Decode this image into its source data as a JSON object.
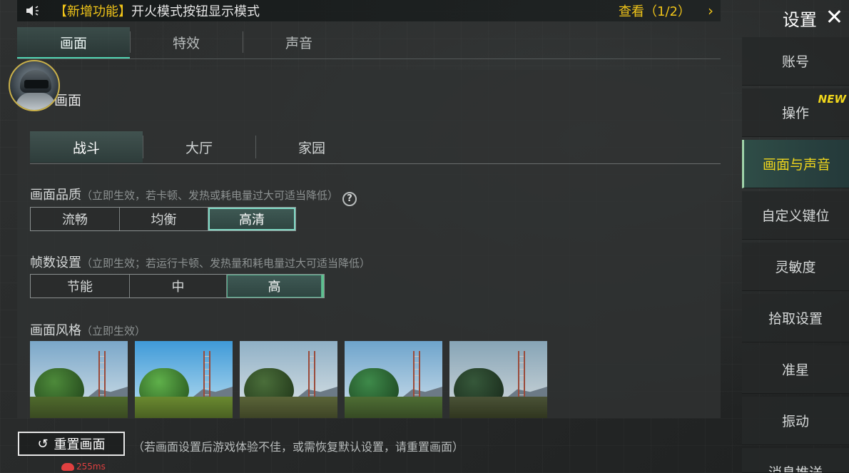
{
  "notice": {
    "speaker_icon": "speaker-icon",
    "tag": "【新增功能】",
    "message": "开火模式按钮显示模式",
    "view": "查看（1/2）",
    "arrow": "›"
  },
  "top_tabs": [
    {
      "label": "画面",
      "active": true
    },
    {
      "label": "特效",
      "active": false
    },
    {
      "label": "声音",
      "active": false
    }
  ],
  "section_title": "画面",
  "sub_tabs": [
    {
      "label": "战斗",
      "active": true
    },
    {
      "label": "大厅",
      "active": false
    },
    {
      "label": "家园",
      "active": false
    }
  ],
  "quality": {
    "label": "画面品质",
    "hint": "（立即生效，若卡顿、发热或耗电量过大可适当降低）",
    "help": "?",
    "options": [
      "流畅",
      "均衡",
      "高清"
    ],
    "selected": "高清"
  },
  "fps": {
    "label": "帧数设置",
    "hint": "（立即生效；若运行卡顿、发热量和耗电量过大可适当降低）",
    "options": [
      "节能",
      "中",
      "高"
    ],
    "selected": "高"
  },
  "style": {
    "label": "画面风格",
    "hint": "（立即生效）",
    "selected_index": 0
  },
  "reset": {
    "icon": "↺",
    "label": "重置画面",
    "note": "（若画面设置后游戏体验不佳，或需恢复默认设置，请重置画面）"
  },
  "ping": "255ms",
  "sidebar": {
    "title": "设置",
    "close": "✕",
    "items": [
      {
        "label": "账号",
        "active": false
      },
      {
        "label": "操作",
        "active": false,
        "badge": "NEW"
      },
      {
        "label": "画面与声音",
        "active": true
      },
      {
        "label": "自定义键位",
        "active": false
      },
      {
        "label": "灵敏度",
        "active": false
      },
      {
        "label": "拾取设置",
        "active": false
      },
      {
        "label": "准星",
        "active": false
      },
      {
        "label": "振动",
        "active": false
      },
      {
        "label": "消息推送",
        "active": false
      }
    ]
  },
  "colors": {
    "accent_yellow": "#f0d61c",
    "accent_teal": "#4fd1b0"
  }
}
